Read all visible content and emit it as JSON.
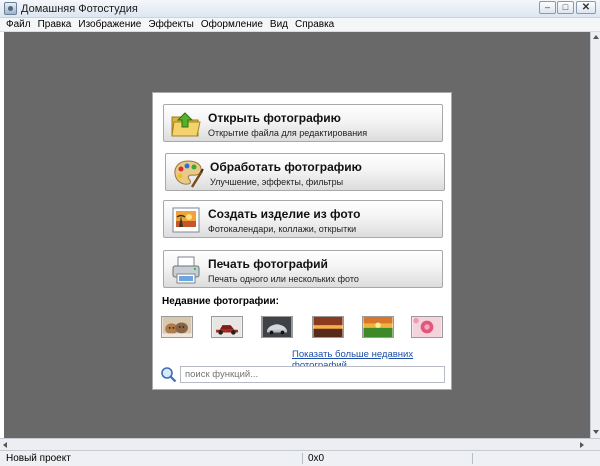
{
  "window": {
    "title": "Домашняя Фотостудия",
    "minimize_glyph": "‒",
    "maximize_glyph": "□",
    "close_glyph": "✕"
  },
  "menu": [
    "Файл",
    "Правка",
    "Изображение",
    "Эффекты",
    "Оформление",
    "Вид",
    "Справка"
  ],
  "actions": [
    {
      "title": "Открыть фотографию",
      "subtitle": "Открытие файла для редактирования",
      "icon": "folder-open-icon"
    },
    {
      "title": "Обработать фотографию",
      "subtitle": "Улучшение, эффекты, фильтры",
      "icon": "palette-icon"
    },
    {
      "title": "Создать изделие из фото",
      "subtitle": "Фотокалендари, коллажи, открытки",
      "icon": "photo-frame-icon"
    },
    {
      "title": "Печать фотографий",
      "subtitle": "Печать одного или нескольких фото",
      "icon": "printer-icon"
    }
  ],
  "recent": {
    "label": "Недавние фотографии:",
    "thumbnails": [
      "kittens",
      "vintage-car",
      "silver-car",
      "sunset-field",
      "green-field",
      "pink-flower"
    ],
    "more_link": "Показать больше недавних фотографий"
  },
  "search": {
    "placeholder": "поиск функций..."
  },
  "status": {
    "left": "Новый проект",
    "dimensions": "0x0"
  },
  "colors": {
    "workspace": "#696969",
    "link": "#1d4fa8",
    "panel_border": "#a9a9a9"
  }
}
